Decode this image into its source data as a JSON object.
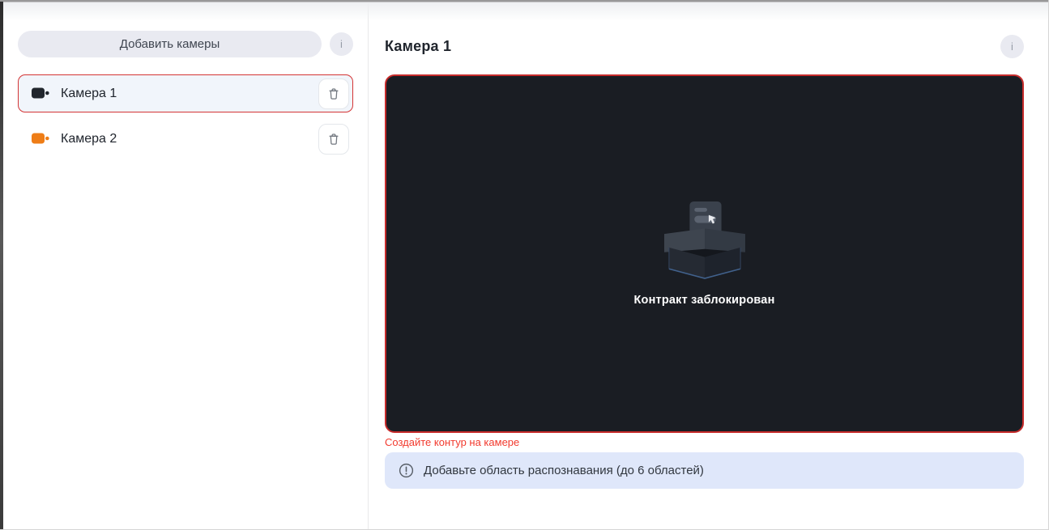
{
  "sidebar": {
    "add_button_label": "Добавить камеры",
    "info_icon_glyph": "i",
    "cameras": [
      {
        "label": "Камера 1",
        "selected": true,
        "icon": "video-camera-icon",
        "icon_color": "#21262d"
      },
      {
        "label": "Камера 2",
        "selected": false,
        "icon": "video-camera-icon",
        "icon_color": "#ee7d17"
      }
    ],
    "delete_icon": "trash-icon"
  },
  "main": {
    "title": "Камера 1",
    "info_icon_glyph": "i",
    "video_status": "Контракт заблокирован",
    "video_illustration": "empty-open-box-with-document-and-cursor",
    "error_text": "Создайте контур на камере",
    "banner": {
      "icon": "alert-circle-icon",
      "text": "Добавьте область распознавания (до 6 областей)"
    }
  },
  "colors": {
    "selection_red": "#d43434",
    "video_border_red": "#c62b2b",
    "error_red": "#f23a2e",
    "sidebar_button_bg": "#e9eaf1",
    "selected_item_bg": "#f1f5fb",
    "banner_bg": "#dfe7fa",
    "video_bg": "#1a1d23",
    "camera1_icon_color": "#21262d",
    "camera2_icon_color": "#ee7d17"
  }
}
